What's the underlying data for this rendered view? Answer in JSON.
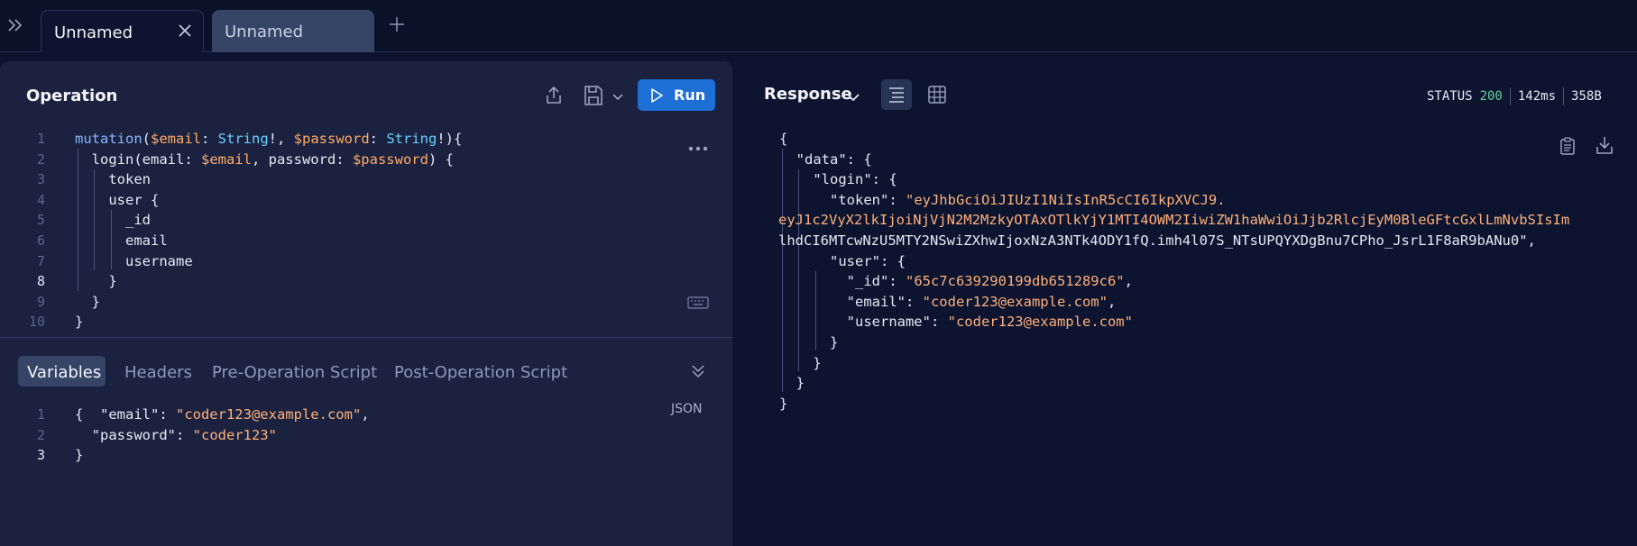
{
  "tabs": [
    {
      "label": "Unnamed",
      "active": true
    },
    {
      "label": "Unnamed",
      "active": false
    }
  ],
  "operation": {
    "title": "Operation",
    "run_label": "Run",
    "lines": [
      "mutation($email: String!, $password: String!){",
      "  login(email: $email, password: $password) {",
      "    token",
      "    user {",
      "      _id",
      "      email",
      "      username",
      "    }",
      "  }",
      "}"
    ],
    "line_numbers": [
      "1",
      "2",
      "3",
      "4",
      "5",
      "6",
      "7",
      "8",
      "9",
      "10"
    ]
  },
  "variables_panel": {
    "tabs": [
      "Variables",
      "Headers",
      "Pre-Operation Script",
      "Post-Operation Script"
    ],
    "format_label": "JSON",
    "line_numbers": [
      "1",
      "2",
      "3"
    ],
    "lines": [
      "{  \"email\": \"coder123@example.com\",",
      "  \"password\": \"coder123\"",
      "}"
    ]
  },
  "response": {
    "title": "Response",
    "status_label": "STATUS",
    "status_code": "200",
    "time": "142ms",
    "size": "358B",
    "lines": [
      "{",
      "  \"data\": {",
      "    \"login\": {",
      "      \"token\": \"eyJhbGciOiJIUzI1NiIsInR5cCI6IkpXVCJ9.",
      "eyJ1c2VyX2lkIjoiNjVjN2M2MzkyOTAxOTlkYjY1MTI4OWM2IiwiZW1haWwiOiJjb2RlcjEyM0BleGFtcGxlLmNvbSIsIm",
      "lhdCI6MTcwNzU5MTY2NSwiZXhwIjoxNzA3NTk4ODY1fQ.imh4l07S_NTsUPQYXDgBnu7CPho_JsrL1F8aR9bANu0\",",
      "      \"user\": {",
      "        \"_id\": \"65c7c639290199db651289c6\",",
      "        \"email\": \"coder123@example.com\",",
      "        \"username\": \"coder123@example.com\"",
      "      }",
      "    }",
      "  }",
      "}"
    ]
  },
  "icons": {
    "collapse": "double-chevron-right-icon",
    "close": "close-icon",
    "add": "plus-icon",
    "share": "share-icon",
    "save": "save-icon",
    "more": "more-horizontal-icon",
    "keyboard": "keyboard-icon",
    "copy": "clipboard-icon",
    "download": "download-icon"
  },
  "colors": {
    "accent": "#1d6fd6",
    "status_ok": "#5fd39b",
    "string": "#ffb07a",
    "variable": "#ffaa66",
    "type": "#6ad0ff",
    "keyword": "#8bb4ff"
  }
}
